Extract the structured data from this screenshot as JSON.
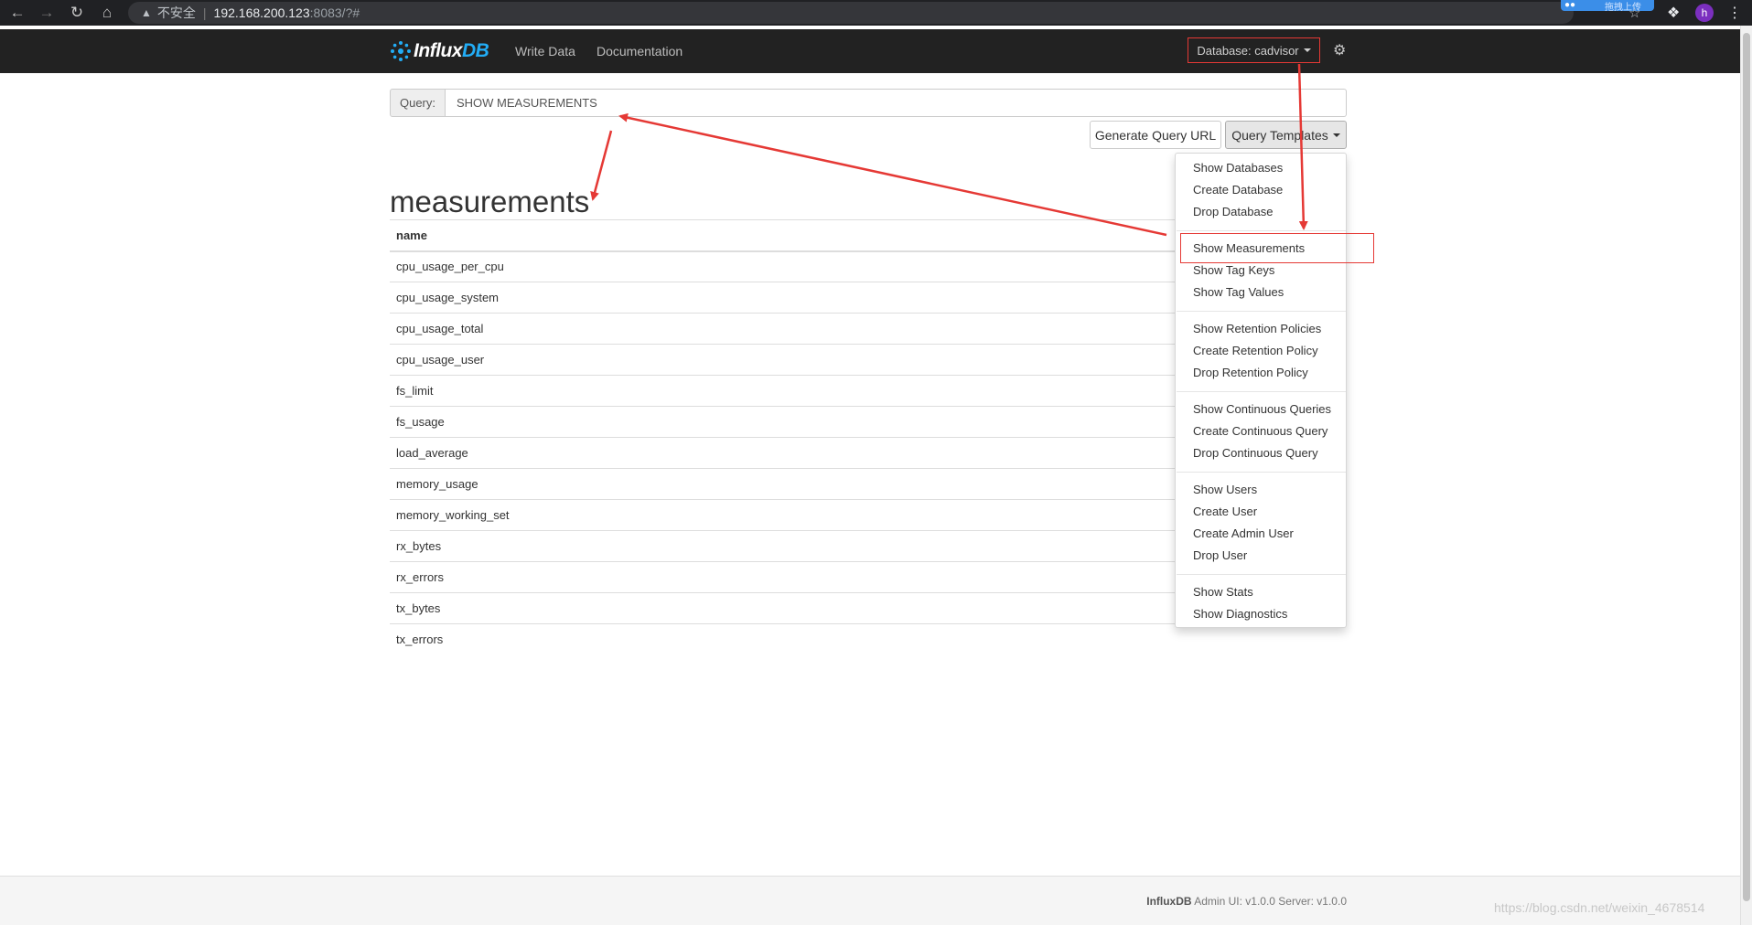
{
  "browser": {
    "security_label": "不安全",
    "url_host": "192.168.200.123",
    "url_path": ":8083/?#",
    "upload_badge": "拖拽上传",
    "avatar_letter": "h"
  },
  "navbar": {
    "brand_a": "Influx",
    "brand_b": "DB",
    "write_data": "Write Data",
    "documentation": "Documentation",
    "database_label": "Database: cadvisor"
  },
  "query": {
    "label": "Query:",
    "value": "SHOW MEASUREMENTS",
    "generate_url": "Generate Query URL",
    "templates": "Query Templates"
  },
  "templates_menu": [
    "Show Databases",
    "Create Database",
    "Drop Database",
    "Show Measurements",
    "Show Tag Keys",
    "Show Tag Values",
    "Show Retention Policies",
    "Create Retention Policy",
    "Drop Retention Policy",
    "Show Continuous Queries",
    "Create Continuous Query",
    "Drop Continuous Query",
    "Show Users",
    "Create User",
    "Create Admin User",
    "Drop User",
    "Show Stats",
    "Show Diagnostics"
  ],
  "results": {
    "title": "measurements",
    "column": "name",
    "rows": [
      "cpu_usage_per_cpu",
      "cpu_usage_system",
      "cpu_usage_total",
      "cpu_usage_user",
      "fs_limit",
      "fs_usage",
      "load_average",
      "memory_usage",
      "memory_working_set",
      "rx_bytes",
      "rx_errors",
      "tx_bytes",
      "tx_errors"
    ]
  },
  "footer": {
    "brand": "InfluxDB",
    "text": " Admin UI: v1.0.0 Server: v1.0.0"
  },
  "watermark": "https://blog.csdn.net/weixin_4678514",
  "colors": {
    "navbar_bg": "#222222",
    "brand_accent": "#22adf6",
    "annotation_red": "#e53935"
  }
}
